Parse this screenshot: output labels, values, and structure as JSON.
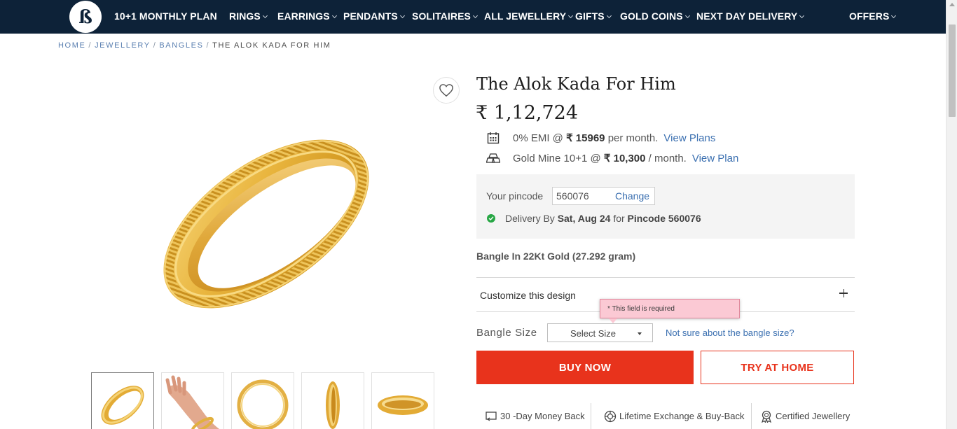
{
  "nav": {
    "items": [
      {
        "label": "10+1 MONTHLY PLAN",
        "dropdown": false
      },
      {
        "label": "RINGS",
        "dropdown": true
      },
      {
        "label": "EARRINGS",
        "dropdown": true
      },
      {
        "label": "PENDANTS",
        "dropdown": true
      },
      {
        "label": "SOLITAIRES",
        "dropdown": true
      },
      {
        "label": "ALL JEWELLERY",
        "dropdown": true
      },
      {
        "label": "GIFTS",
        "dropdown": true
      },
      {
        "label": "GOLD COINS",
        "dropdown": true
      },
      {
        "label": "NEXT DAY DELIVERY",
        "dropdown": true
      },
      {
        "label": "OFFERS",
        "dropdown": true
      }
    ],
    "bg_color": "#0d2238"
  },
  "breadcrumb": {
    "items": [
      "HOME",
      "JEWELLERY",
      "BANGLES"
    ],
    "current": "THE ALOK KADA FOR HIM"
  },
  "product": {
    "title": "The Alok Kada For Him",
    "price": "₹ 1,12,724",
    "emi": {
      "prefix": "0% EMI @",
      "amount": "₹ 15969",
      "suffix": "per month.",
      "link": "View Plans"
    },
    "goldmine": {
      "prefix": "Gold Mine 10+1 @",
      "amount": "₹ 10,300",
      "suffix": "/ month.",
      "link": "View Plan"
    },
    "description": "Bangle In 22Kt Gold (27.292 gram)"
  },
  "delivery": {
    "pincode_label": "Your pincode",
    "pincode_value": "560076",
    "change_label": "Change",
    "prefix": "Delivery By",
    "date": "Sat, Aug 24",
    "middle": "for",
    "pincode_text": "Pincode 560076"
  },
  "customize": {
    "label": "Customize this design"
  },
  "validation": {
    "message": "* This field is required"
  },
  "size": {
    "label": "Bangle Size",
    "select_value": "Select Size",
    "help_link": "Not sure about the bangle size?"
  },
  "actions": {
    "buy_now": "BUY NOW",
    "try_at_home": "TRY AT HOME",
    "accent_color": "#e8331c"
  },
  "assurances": [
    {
      "label": "30 -Day Money Back",
      "icon": "return-icon"
    },
    {
      "label": "Lifetime Exchange & Buy-Back",
      "icon": "exchange-icon"
    },
    {
      "label": "Certified Jewellery",
      "icon": "certificate-icon"
    }
  ],
  "thumbnails": [
    {
      "icon": "bangle-front-thumb"
    },
    {
      "icon": "bangle-on-wrist-thumb"
    },
    {
      "icon": "bangle-top-thumb"
    },
    {
      "icon": "bangle-side-thumb"
    },
    {
      "icon": "bangle-flat-thumb"
    }
  ]
}
